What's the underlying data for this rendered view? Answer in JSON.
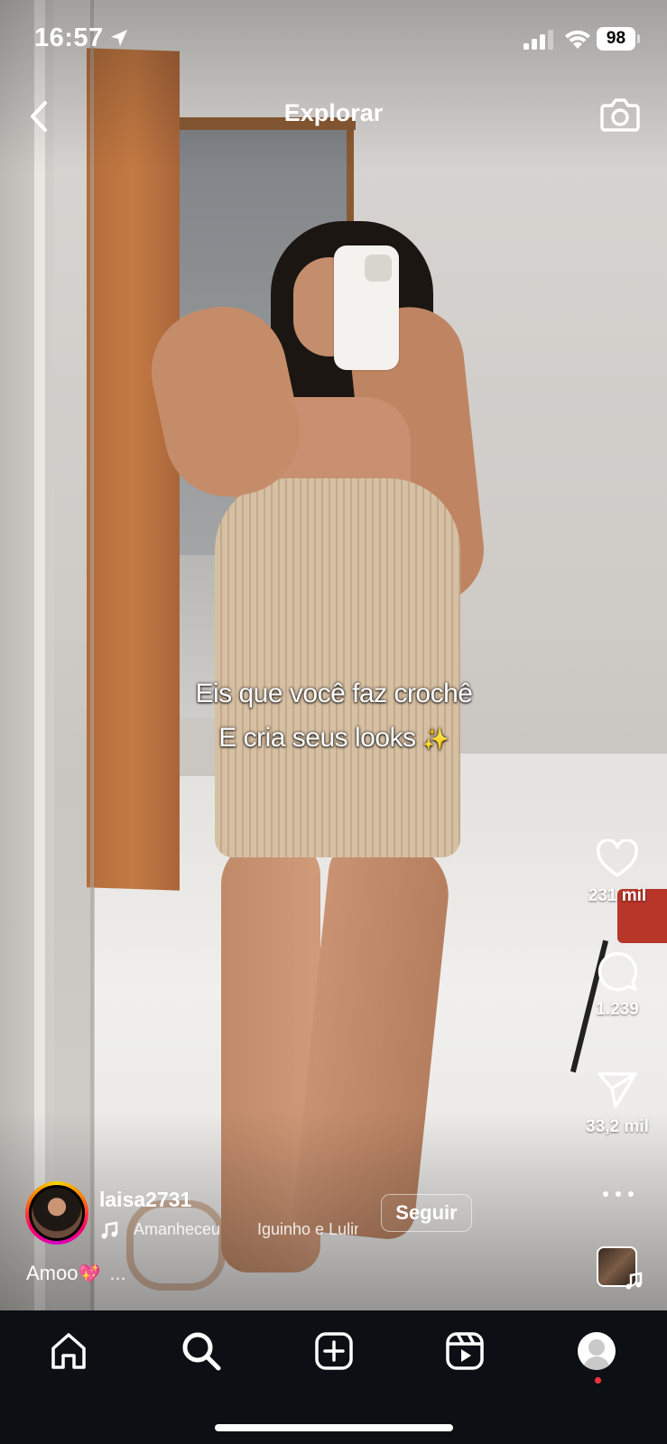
{
  "status_bar": {
    "time": "16:57",
    "battery": "98"
  },
  "header": {
    "title": "Explorar"
  },
  "overlay": {
    "line1": "Eis que você faz crochê",
    "line2": "E cria seus looks",
    "emoji": "✨"
  },
  "actions": {
    "likes": "231 mil",
    "comments": "1.239",
    "shares": "33,2 mil"
  },
  "post": {
    "username": "laisa2731",
    "follow_label": "Seguir",
    "music_track": "Amanheceu",
    "music_artist": "Iguinho e Lulinha",
    "caption": "Amoo",
    "caption_emoji": "💖",
    "caption_more": "..."
  },
  "icons": {
    "back": "chevron-left-icon",
    "camera": "camera-icon",
    "like": "heart-icon",
    "comment": "comment-icon",
    "share": "send-icon",
    "more": "more-icon",
    "music": "music-note-icon",
    "home": "home-icon",
    "search": "search-icon",
    "create": "plus-square-icon",
    "reels": "reels-icon",
    "profile": "profile-icon"
  }
}
